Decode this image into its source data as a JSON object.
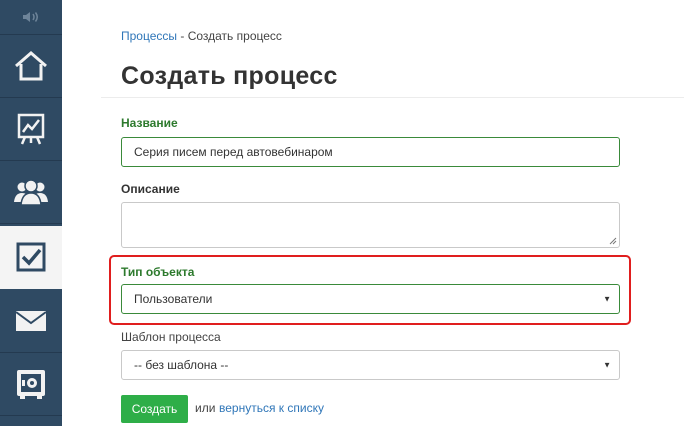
{
  "breadcrumb": {
    "parent_label": "Процессы",
    "separator": "-",
    "current_label": "Создать процесс"
  },
  "page": {
    "title": "Создать процесс"
  },
  "form": {
    "name": {
      "label": "Название",
      "value": "Серия писем перед автовебинаром"
    },
    "description": {
      "label": "Описание",
      "value": ""
    },
    "object_type": {
      "label": "Тип объекта",
      "selected": "Пользователи"
    },
    "template": {
      "label": "Шаблон процесса",
      "selected": "-- без шаблона --"
    },
    "submit_label": "Создать",
    "or_text": "или",
    "back_link_label": "вернуться к списку"
  },
  "sidebar": {
    "items": [
      {
        "icon": "volume-icon"
      },
      {
        "icon": "home-icon"
      },
      {
        "icon": "chart-icon"
      },
      {
        "icon": "users-icon"
      },
      {
        "icon": "checkbox-icon",
        "active": true
      },
      {
        "icon": "mail-icon"
      },
      {
        "icon": "safe-icon"
      }
    ]
  },
  "colors": {
    "sidebar_bg": "#2f4a63",
    "accent_green": "#2eae48",
    "label_green": "#2d7a2d",
    "link_blue": "#2f76b8",
    "highlight_red": "#e01e1e"
  }
}
